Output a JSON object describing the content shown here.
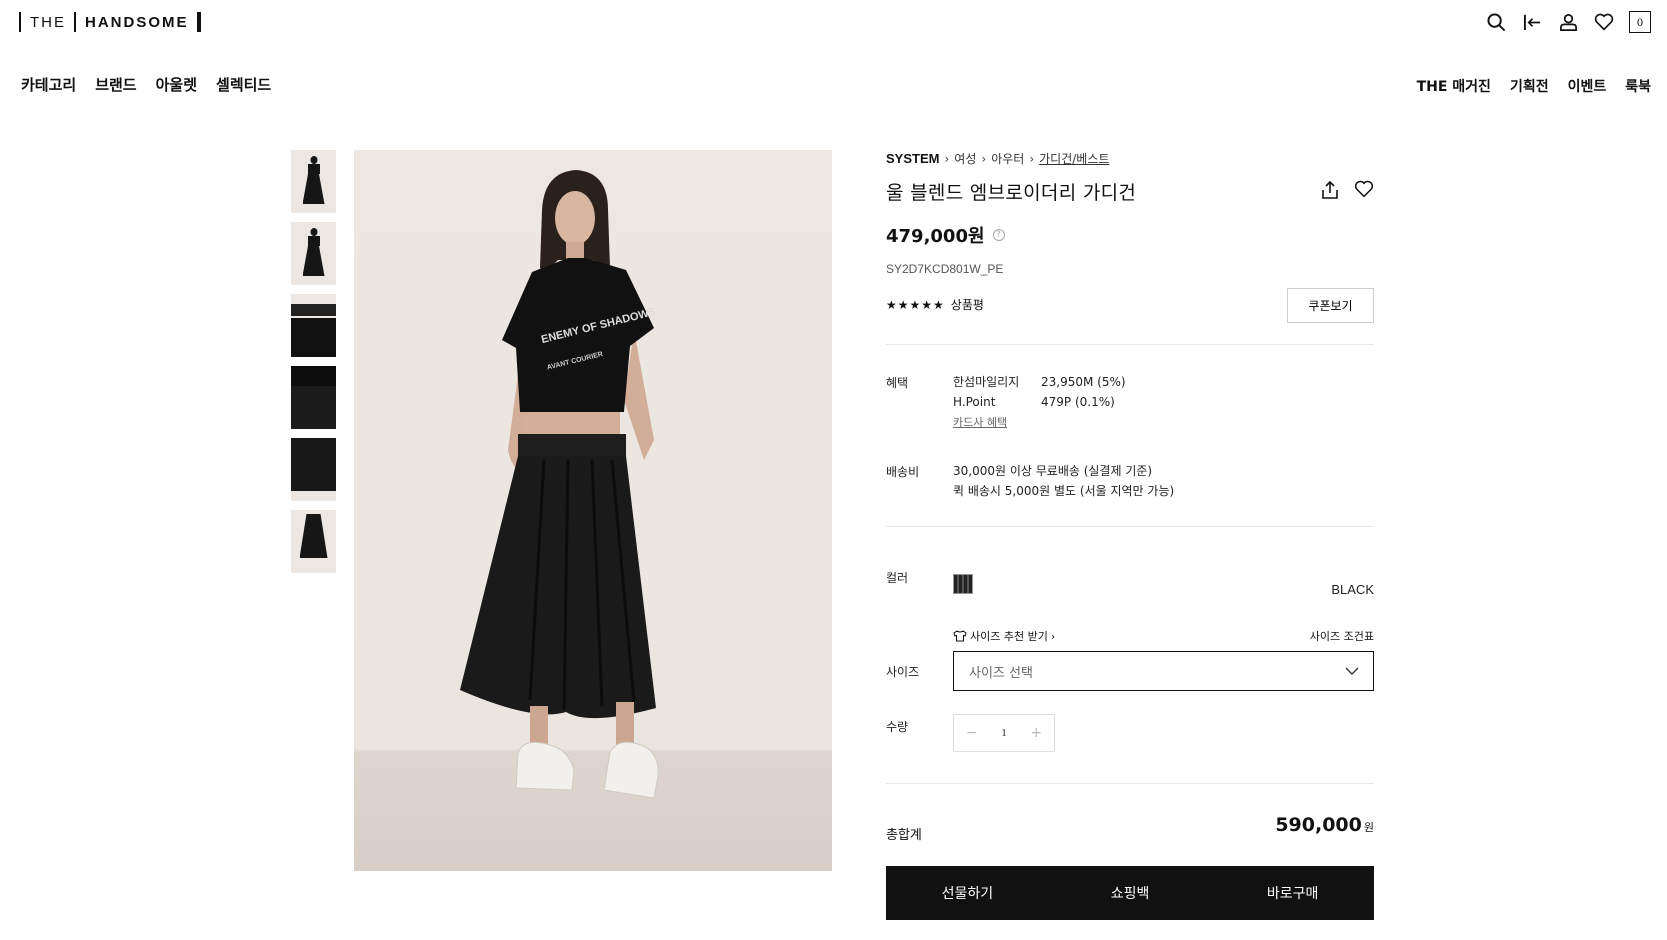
{
  "header": {
    "logo_left": "THE",
    "logo_right": "HANDSOME",
    "cart_count": "0",
    "icons": [
      "search-icon",
      "login-icon",
      "user-icon",
      "heart-icon",
      "cart-icon"
    ]
  },
  "nav_left": [
    "카테고리",
    "브랜드",
    "아울렛",
    "셀렉티드"
  ],
  "nav_right": [
    "THE 매거진",
    "기획전",
    "이벤트",
    "룩북"
  ],
  "breadcrumb": {
    "brand": "SYSTEM",
    "items": [
      "여성",
      "아우터",
      "가디건/베스트"
    ]
  },
  "product": {
    "title": "울 블렌드 엠브로이더리 가디건",
    "price": "479,000원",
    "code": "SY2D7KCD801W_PE",
    "stars": "★★★★★",
    "rating_rating_link": "상품평",
    "coupon_button": "쿠폰보기",
    "tshirt_text": [
      "ENEMY OF SHADOWS",
      "AVANT COURIER"
    ]
  },
  "benefits": {
    "label": "혜택",
    "rows": [
      {
        "k": "한섬마일리지",
        "v": "23,950M (5%)"
      },
      {
        "k": "H.Point",
        "v": "479P (0.1%)"
      }
    ],
    "card_link": "카드사 혜택"
  },
  "shipping": {
    "label": "배송비",
    "line1": "30,000원 이상 무료배송 (실결제 기준)",
    "line2": "퀵 배송시 5,000원 별도 (서울 지역만 가능)"
  },
  "options": {
    "color_label": "컬러",
    "color_name": "BLACK",
    "size_reco": "사이즈 추천 받기",
    "size_chart": "사이즈 조건표",
    "size_label": "사이즈",
    "size_placeholder": "사이즈 선택",
    "qty_label": "수량",
    "qty_value": "1"
  },
  "total": {
    "label": "총합계",
    "value": "590,000",
    "unit": "원"
  },
  "actions": [
    "선물하기",
    "쇼핑백",
    "바로구매"
  ]
}
